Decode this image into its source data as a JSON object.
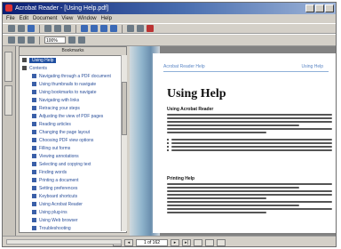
{
  "window": {
    "title": "Acrobat Reader - [Using Help.pdf]",
    "accent": "#0a1f74"
  },
  "menu": [
    "File",
    "Edit",
    "Document",
    "View",
    "Window",
    "Help"
  ],
  "toolbar": {
    "zoom": "100%"
  },
  "bookmarks": {
    "header": "Bookmarks",
    "items": [
      {
        "label": "Using Help",
        "top": true,
        "selected": true
      },
      {
        "label": "Contents",
        "top": true
      },
      {
        "label": "Navigating through a PDF document",
        "child": true
      },
      {
        "label": "Using thumbnails to navigate",
        "child": true
      },
      {
        "label": "Using bookmarks to navigate",
        "child": true
      },
      {
        "label": "Navigating with links",
        "child": true
      },
      {
        "label": "Retracing your steps",
        "child": true
      },
      {
        "label": "Adjusting the view of PDF pages",
        "child": true
      },
      {
        "label": "Reading articles",
        "child": true
      },
      {
        "label": "Changing the page layout",
        "child": true
      },
      {
        "label": "Choosing PDF view options",
        "child": true
      },
      {
        "label": "Filling out forms",
        "child": true
      },
      {
        "label": "Viewing annotations",
        "child": true
      },
      {
        "label": "Selecting and copying text",
        "child": true
      },
      {
        "label": "Finding words",
        "child": true
      },
      {
        "label": "Printing a document",
        "child": true
      },
      {
        "label": "Setting preferences",
        "child": true
      },
      {
        "label": "Keyboard shortcuts",
        "child": true
      },
      {
        "label": "Using Acrobat Reader",
        "child": true
      },
      {
        "label": "Using plug-ins",
        "child": true
      },
      {
        "label": "Using Web browser",
        "child": true
      },
      {
        "label": "Troubleshooting",
        "child": true
      }
    ]
  },
  "document": {
    "header": "Acrobat Reader Help",
    "page_label": "Using Help",
    "title": "Using Help",
    "section1": "Using Acrobat Reader",
    "section2": "Printing Help"
  },
  "status": {
    "page": "1 of 162"
  }
}
